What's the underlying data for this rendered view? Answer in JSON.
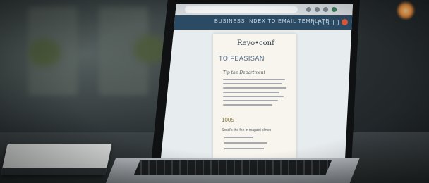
{
  "header": {
    "title": "BUSINESS INDEX TO EMAIL TEMPLATE"
  },
  "document": {
    "brand": "Reyo•conf",
    "heading": "TO FEASISAN",
    "subheading": "Tip the Department",
    "number": "1005",
    "section_title": "Sessi's the fon in magaet clmes"
  },
  "colors": {
    "header_bar": "#2b4a63",
    "accent_avatar": "#d85a3a",
    "lamp": "#e88b3a"
  }
}
